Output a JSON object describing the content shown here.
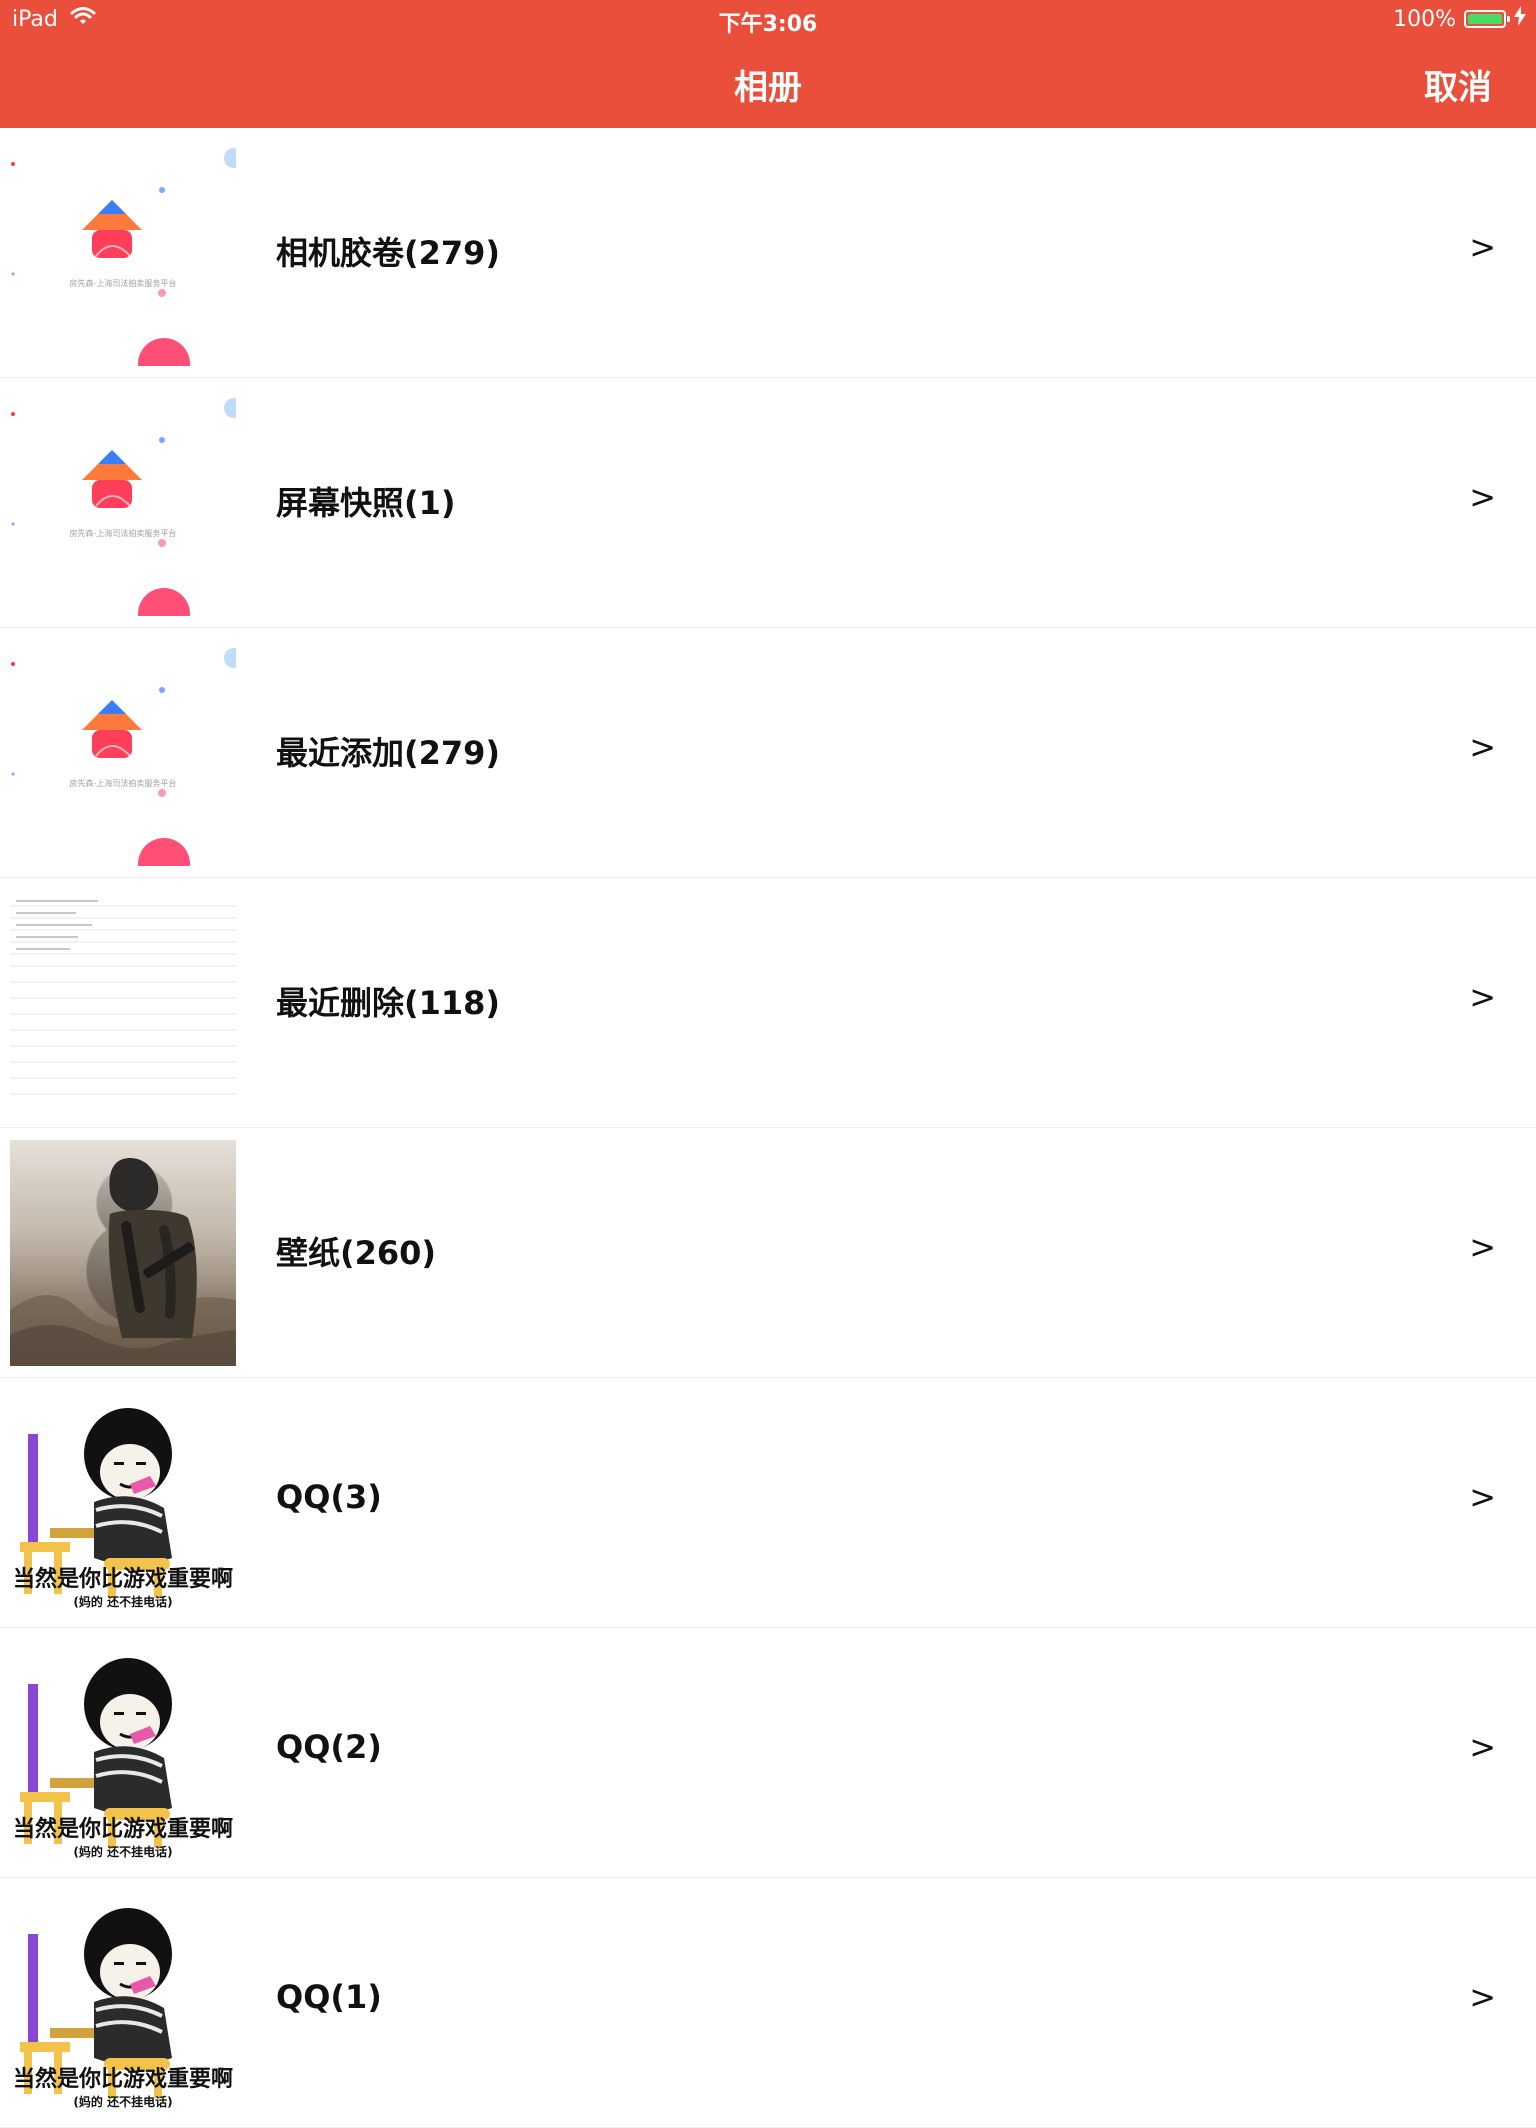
{
  "status_bar": {
    "device": "iPad",
    "time": "下午3:06",
    "battery": "100%"
  },
  "nav": {
    "title": "相册",
    "cancel": "取消"
  },
  "albums": [
    {
      "label": "相机胶卷(279)",
      "chevron": ">",
      "thumb": {
        "type": "screen",
        "caption": "房先森-上海司法拍卖服务平台"
      }
    },
    {
      "label": "屏幕快照(1)",
      "chevron": ">",
      "thumb": {
        "type": "screen",
        "caption": "房先森-上海司法拍卖服务平台"
      }
    },
    {
      "label": "最近添加(279)",
      "chevron": ">",
      "thumb": {
        "type": "screen",
        "caption": "房先森-上海司法拍卖服务平台"
      }
    },
    {
      "label": "最近删除(118)",
      "chevron": ">",
      "thumb": {
        "type": "lines"
      }
    },
    {
      "label": "壁纸(260)",
      "chevron": ">",
      "thumb": {
        "type": "photo"
      }
    },
    {
      "label": "QQ(3)",
      "chevron": ">",
      "thumb": {
        "type": "meme",
        "caption": "当然是你比游戏重要啊",
        "sub": "(妈的 还不挂电话)"
      }
    },
    {
      "label": "QQ(2)",
      "chevron": ">",
      "thumb": {
        "type": "meme",
        "caption": "当然是你比游戏重要啊",
        "sub": "(妈的 还不挂电话)"
      }
    },
    {
      "label": "QQ(1)",
      "chevron": ">",
      "thumb": {
        "type": "meme",
        "caption": "当然是你比游戏重要啊",
        "sub": "(妈的 还不挂电话)"
      }
    }
  ],
  "colors": {
    "accent": "#e94f3b",
    "text": "#111111",
    "divider": "#eceef1"
  }
}
